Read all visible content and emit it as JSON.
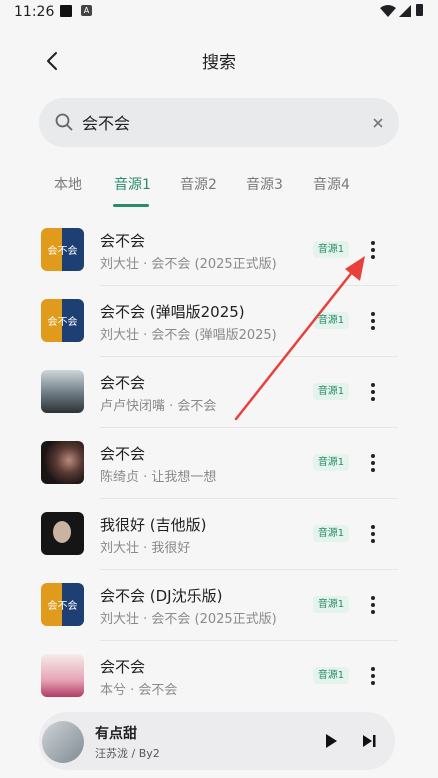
{
  "status_bar": {
    "time": "11:26",
    "a_badge": "A"
  },
  "header": {
    "title": "搜索"
  },
  "search": {
    "value": "会不会",
    "placeholder": ""
  },
  "tabs": [
    {
      "label": "本地",
      "active": false
    },
    {
      "label": "音源1",
      "active": true
    },
    {
      "label": "音源2",
      "active": false
    },
    {
      "label": "音源3",
      "active": false
    },
    {
      "label": "音源4",
      "active": false
    }
  ],
  "songs": [
    {
      "title": "会不会",
      "subtitle": "刘大壮 · 会不会 (2025正式版)",
      "source": "音源1",
      "cover_text": "会不会"
    },
    {
      "title": "会不会 (弹唱版2025)",
      "subtitle": "刘大壮 · 会不会 (弹唱版2025)",
      "source": "音源1",
      "cover_text": "会不会"
    },
    {
      "title": "会不会",
      "subtitle": "卢卢快闭嘴 · 会不会",
      "source": "音源1",
      "cover_text": ""
    },
    {
      "title": "会不会",
      "subtitle": "陈绮贞 · 让我想一想",
      "source": "音源1",
      "cover_text": ""
    },
    {
      "title": "我很好 (吉他版)",
      "subtitle": "刘大壮 · 我很好",
      "source": "音源1",
      "cover_text": ""
    },
    {
      "title": "会不会 (DJ沈乐版)",
      "subtitle": "刘大壮 · 会不会 (2025正式版)",
      "source": "音源1",
      "cover_text": "会不会"
    },
    {
      "title": "会不会",
      "subtitle": "本兮 · 会不会",
      "source": "音源1",
      "cover_text": ""
    }
  ],
  "mini_player": {
    "title": "有点甜",
    "subtitle": "汪苏泷 / By2"
  },
  "colors": {
    "accent": "#2a8c6a",
    "arrow": "#e8413c",
    "background": "#f6f6f7"
  }
}
